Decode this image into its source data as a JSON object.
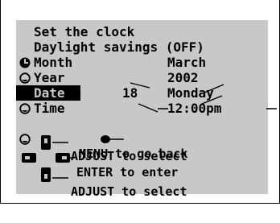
{
  "menu": {
    "title": "Set the clock",
    "items": [
      {
        "label": "Daylight savings (OFF)",
        "value": ""
      },
      {
        "label": "Month",
        "value": "March"
      },
      {
        "label": "Year",
        "value": "2002"
      },
      {
        "label": "Date",
        "value": "Monday",
        "number": "18",
        "selected": true
      },
      {
        "label": "Time",
        "value": "12:00pm"
      }
    ]
  },
  "help": {
    "back": "MENU to go back",
    "adjust_up": "ADJUST to select",
    "enter": "ENTER to enter",
    "adjust_down": "ADJUST to select"
  },
  "colors": {
    "screen_bg": "#c8c8c8",
    "text": "#000000",
    "highlight": "#000000"
  },
  "icons": {
    "title": "clock-set-icon",
    "item": "radio-option-icon",
    "back": "menu-back-icon",
    "dpad": "dpad-icon"
  }
}
